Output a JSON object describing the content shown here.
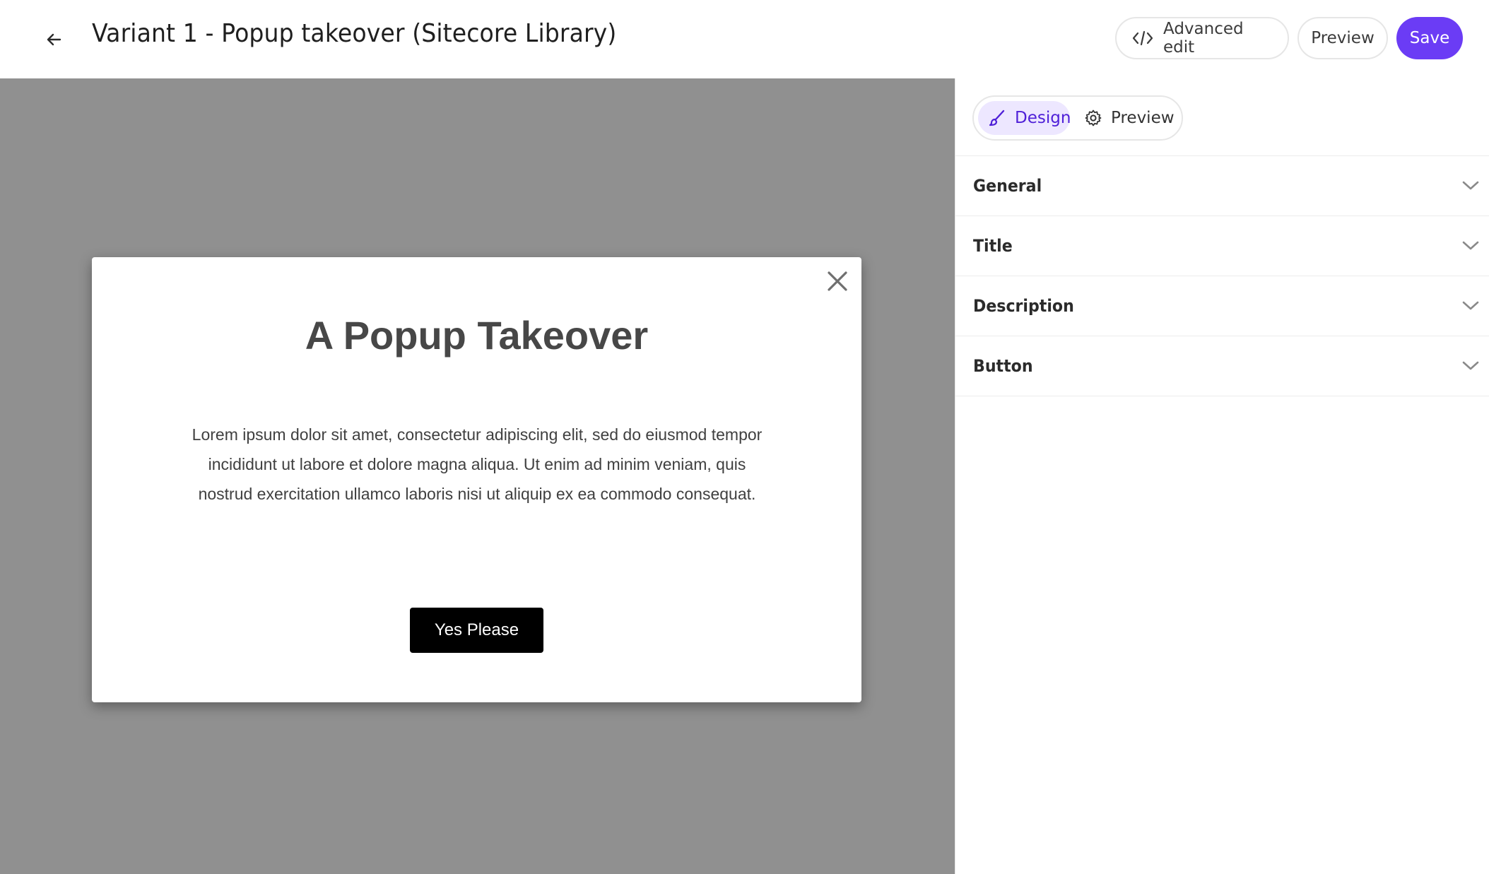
{
  "header": {
    "title": "Variant 1 - Popup takeover (Sitecore Library)",
    "back_icon": "arrow-left-icon",
    "actions": {
      "advanced_edit_label": "Advanced edit",
      "advanced_edit_icon": "code-icon",
      "preview_label": "Preview",
      "save_label": "Save"
    }
  },
  "canvas": {
    "popup": {
      "title": "A Popup Takeover",
      "description": "Lorem ipsum dolor sit amet, consectetur adipiscing elit, sed do eiusmod tempor incididunt ut labore et dolore magna aliqua. Ut enim ad minim veniam, quis nostrud exercitation ullamco laboris nisi ut aliquip ex ea commodo consequat.",
      "button_label": "Yes Please",
      "close_icon": "close-icon"
    }
  },
  "panel": {
    "tabs": [
      {
        "label": "Design",
        "icon": "paintbrush-icon",
        "active": true
      },
      {
        "label": "Preview",
        "icon": "gear-icon",
        "active": false
      }
    ],
    "sections": [
      {
        "label": "General"
      },
      {
        "label": "Title"
      },
      {
        "label": "Description"
      },
      {
        "label": "Button"
      }
    ]
  },
  "colors": {
    "accent": "#6b3cf5",
    "accent_soft": "#ede7ff",
    "canvas_bg": "#909090",
    "popup_button_bg": "#000000"
  }
}
